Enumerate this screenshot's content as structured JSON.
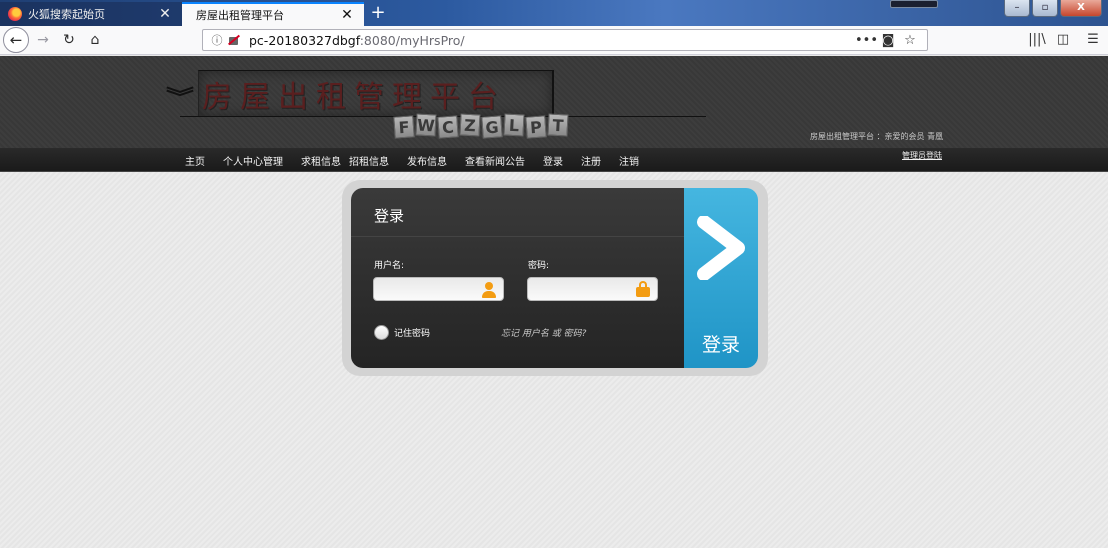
{
  "browser": {
    "tabs": [
      {
        "title": "火狐搜索起始页",
        "active": false,
        "icon": "firefox-logo-icon"
      },
      {
        "title": "房屋出租管理平台",
        "active": true
      }
    ],
    "new_tab": "+",
    "url_host": "pc-20180327dbgf",
    "url_rest": ":8080/myHrsPro/",
    "window_controls": {
      "minimize": "–",
      "maximize": "▫",
      "close": "X"
    },
    "accent_color": "#0a84ff"
  },
  "site": {
    "logo_title": "房屋出租管理平台",
    "logo_letters": [
      "F",
      "W",
      "C",
      "Z",
      "G",
      "L",
      "P",
      "T"
    ],
    "header_status": "房屋出租管理平台 ：亲爱的会员 青凰",
    "menu": [
      "主页",
      "个人中心管理",
      "求租信息",
      "招租信息",
      "发布信息",
      "查看新闻公告",
      "登录",
      "注册",
      "注销"
    ],
    "admin_link": "管理员登陆"
  },
  "login": {
    "title": "登录",
    "username_label": "用户名:",
    "username_value": "",
    "password_label": "密码:",
    "password_value": "",
    "remember_label": "记住密码",
    "forgot_text": "忘记 用户名 或 密码?",
    "submit_label": "登录",
    "submit_color": "#2fa6d6",
    "icon_color": "#f39c12"
  }
}
